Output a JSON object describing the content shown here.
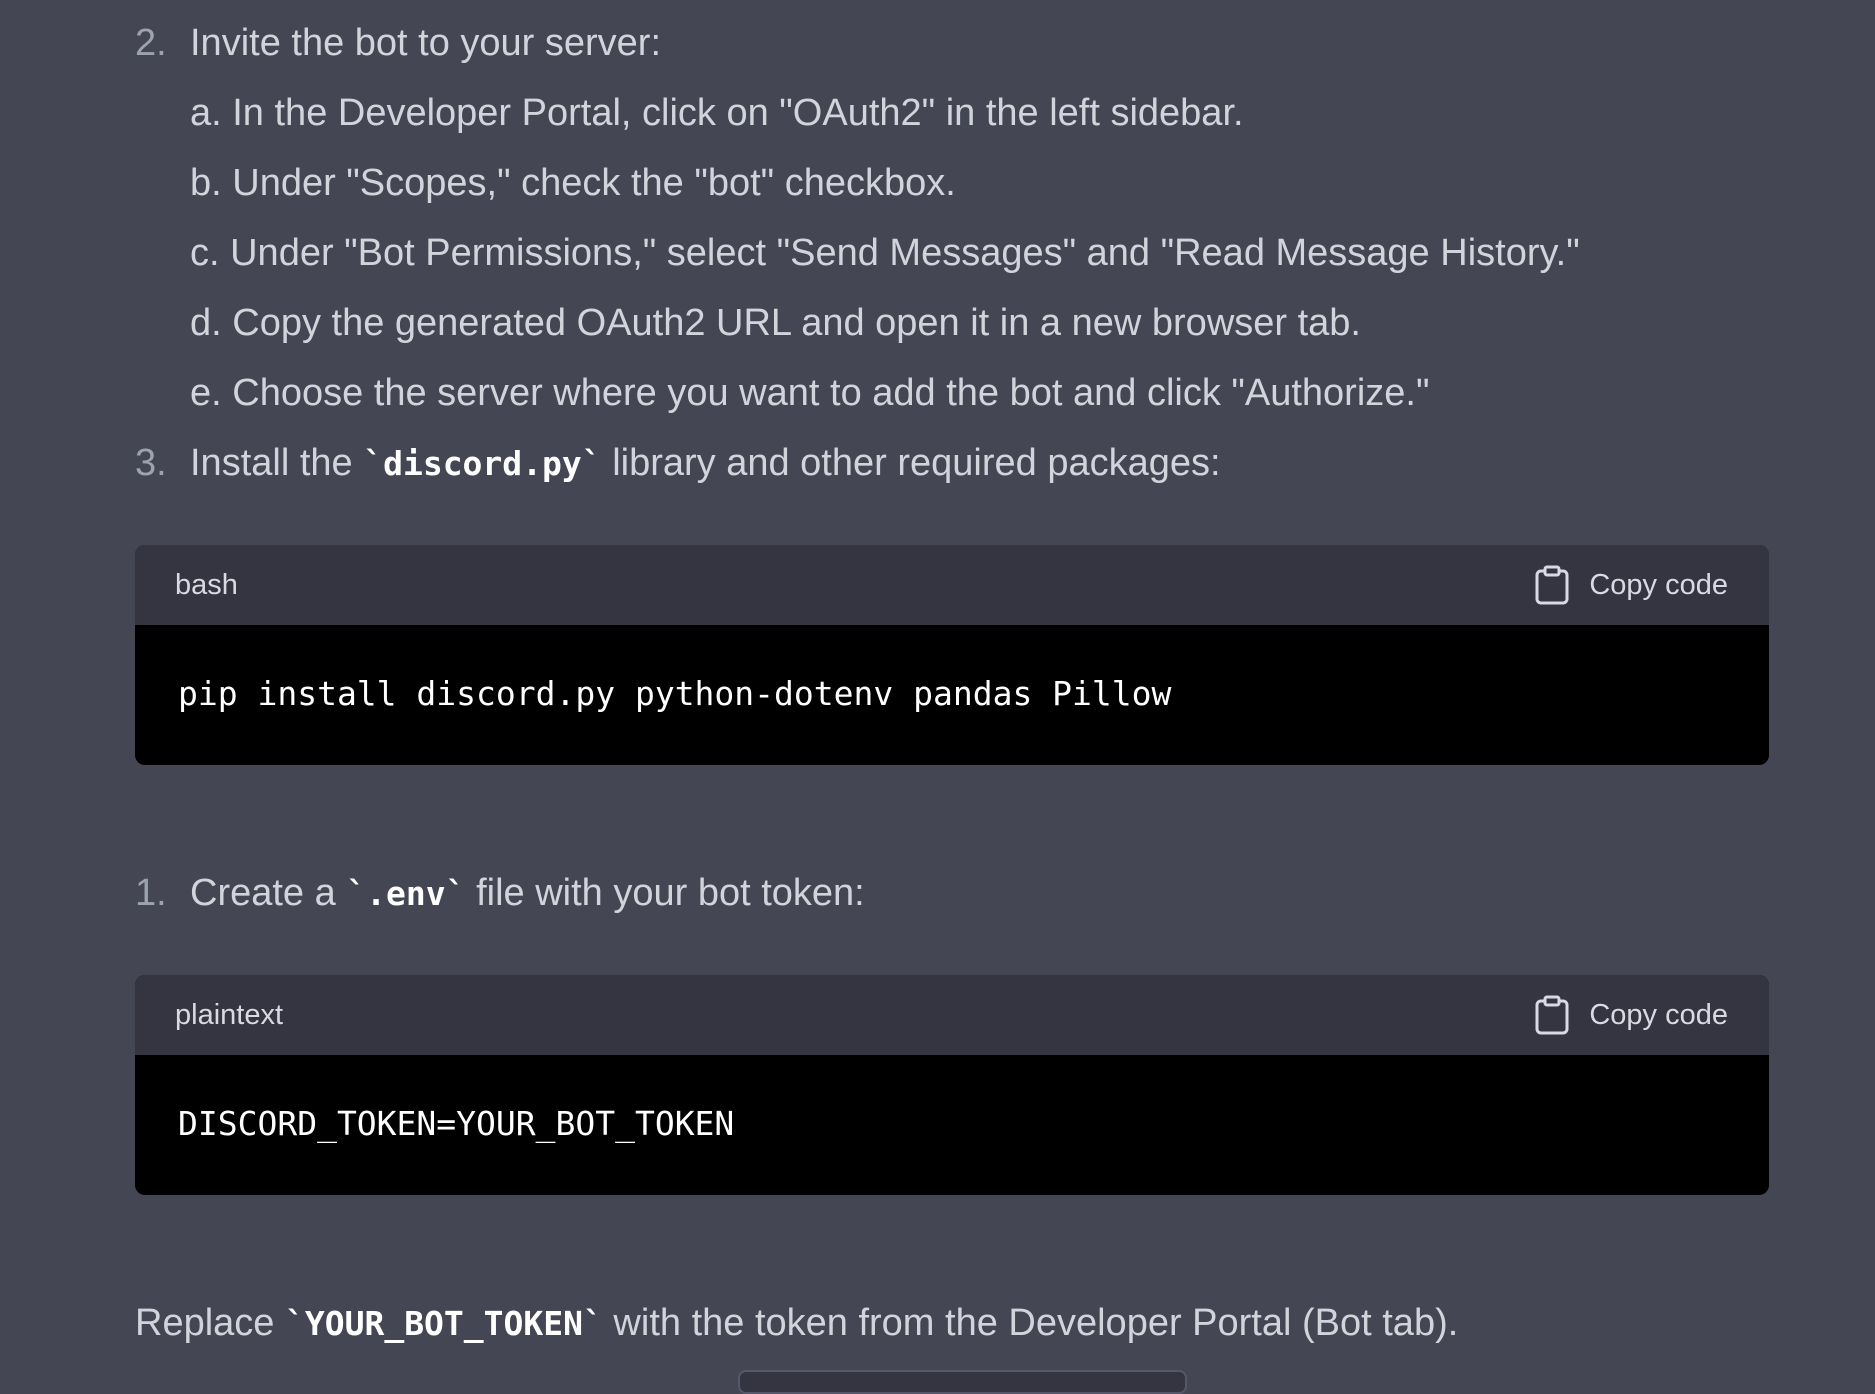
{
  "steps": {
    "invite": {
      "number": "2.",
      "text": "Invite the bot to your server:",
      "subitems": [
        "a. In the Developer Portal, click on \"OAuth2\" in the left sidebar.",
        "b. Under \"Scopes,\" check the \"bot\" checkbox.",
        "c. Under \"Bot Permissions,\" select \"Send Messages\" and \"Read Message History.\"",
        "d. Copy the generated OAuth2 URL and open it in a new browser tab.",
        "e. Choose the server where you want to add the bot and click \"Authorize.\""
      ]
    },
    "install": {
      "number": "3.",
      "before": "Install the ",
      "code": "`discord.py`",
      "after": " library and other required packages:"
    },
    "env": {
      "number": "1.",
      "before": "Create a ",
      "code": "`.env`",
      "after": " file with your bot token:"
    }
  },
  "code_blocks": [
    {
      "language": "bash",
      "copy_label": "Copy code",
      "code": "pip install discord.py python-dotenv pandas Pillow"
    },
    {
      "language": "plaintext",
      "copy_label": "Copy code",
      "code": "DISCORD_TOKEN=YOUR_BOT_TOKEN"
    }
  ],
  "replace_note": {
    "before": "Replace ",
    "code": "`YOUR_BOT_TOKEN`",
    "after": " with the token from the Developer Portal (Bot tab)."
  },
  "colors": {
    "background": "#444654",
    "code_header": "#343541",
    "code_body": "#000000",
    "text": "#d1d5db",
    "list_number": "#9ca3af"
  },
  "icons": {
    "copy": "clipboard-icon"
  }
}
